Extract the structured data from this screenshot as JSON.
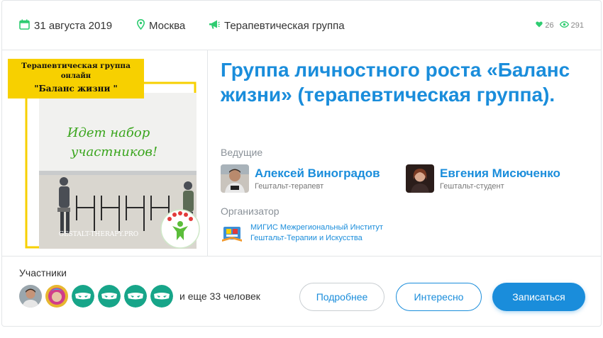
{
  "meta": {
    "date": "31 августа 2019",
    "city": "Москва",
    "group_type": "Терапевтическая группа",
    "likes": "26",
    "views": "291"
  },
  "poster": {
    "line1": "Терапевтическая группа",
    "line2": "онлайн",
    "line3": "\"Баланс жизни \"",
    "script_line1": "Идет набор",
    "script_line2": "участников!",
    "site": "GESTALT-THERAPY.PRO"
  },
  "event": {
    "title": "Группа личностного роста «Баланс жизни» (терапевтическая группа)."
  },
  "hosts_label": "Ведущие",
  "hosts": [
    {
      "name": "Алексей Виноградов",
      "role": "Гештальт-терапевт"
    },
    {
      "name": "Евгения Мисюченко",
      "role": "Гештальт-студент"
    }
  ],
  "organizer_label": "Организатор",
  "organizer": {
    "name": "МИГИС Межрегиональный Институт Гештальт-Терапии и Искусства"
  },
  "participants": {
    "label": "Участники",
    "more": "и еще 33 человек"
  },
  "buttons": {
    "details": "Подробнее",
    "interest": "Интересно",
    "join": "Записаться"
  },
  "colors": {
    "accent": "#1a8ddb",
    "green": "#2ecc71",
    "teal": "#17a589",
    "yellow": "#f7d000"
  }
}
